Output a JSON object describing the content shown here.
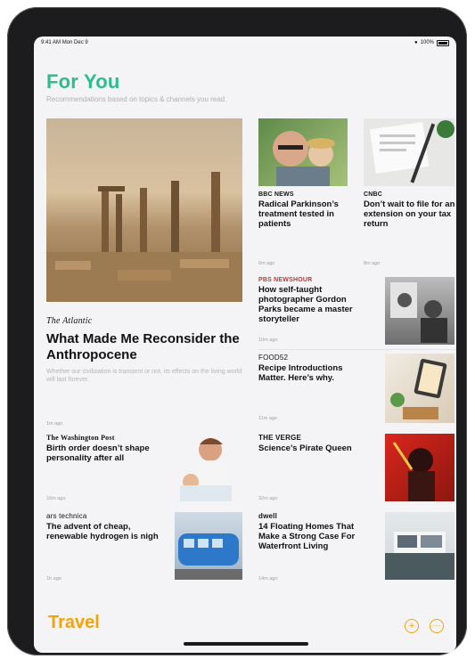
{
  "status_bar": {
    "time": "9:41 AM",
    "date": "Mon Dec 9",
    "battery": "100%"
  },
  "header": {
    "title": "For You",
    "subtitle": "Recommendations based on topics & channels you read."
  },
  "featured": {
    "source": "The Atlantic",
    "headline": "What Made Me Reconsider the Anthropocene",
    "summary": "Whether our civilization is transient or not, its effects on the living world will last forever.",
    "time": "1m ago"
  },
  "articles": [
    {
      "source": "BBC NEWS",
      "headline": "Radical Parkinson’s treatment tested in patients",
      "time": "6m ago"
    },
    {
      "source": "CNBC",
      "headline": "Don’t wait to file for an extension on your tax return",
      "time": "8m ago"
    },
    {
      "source": "PBS NEWSHOUR",
      "headline": "How self-taught photographer Gordon Parks became a master storyteller",
      "time": "10m ago"
    },
    {
      "source": "FOOD52",
      "headline": "Recipe Introductions Matter. Here’s why.",
      "time": "11m ago"
    },
    {
      "source": "The Washington Post",
      "headline": "Birth order doesn’t shape personality after all",
      "time": "16m ago"
    },
    {
      "source": "THE VERGE",
      "headline": "Science’s Pirate Queen",
      "time": "32m ago"
    },
    {
      "source": "ars technica",
      "headline": "The advent of cheap, renewable hydrogen is nigh",
      "time": "1h ago"
    },
    {
      "source": "dwell",
      "headline": "14 Floating Homes That Make a Strong Case For Waterfront Living",
      "time": "14m ago"
    }
  ],
  "bottom_bar": {
    "section": "Travel",
    "add_icon": "plus-circle-icon",
    "more_icon": "ellipsis-circle-icon"
  },
  "colors": {
    "for_you": "#2ebc8b",
    "travel": "#f4a20c"
  }
}
